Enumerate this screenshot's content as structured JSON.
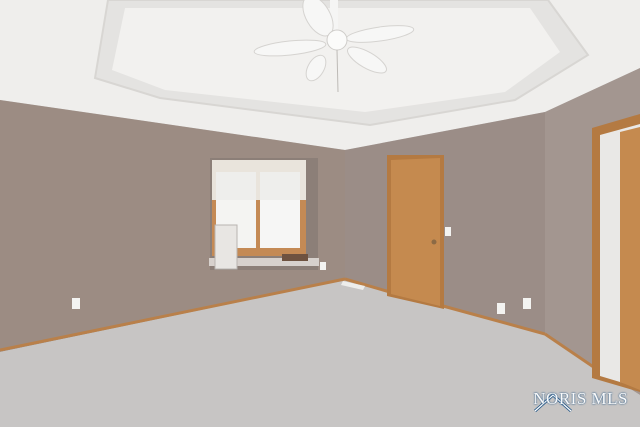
{
  "photo": {
    "subject": "empty-bedroom-with-tray-ceiling",
    "colors": {
      "wall": "#9c8c83",
      "wall_right": "#a39690",
      "ceiling": "#efeeec",
      "carpet": "#c7c5c4",
      "wood": "#c58a4f",
      "trim": "#b9804a"
    }
  },
  "watermark": {
    "text": "NORIS MLS",
    "color": "#2d5d8a",
    "icon": "house-roof-icon"
  }
}
